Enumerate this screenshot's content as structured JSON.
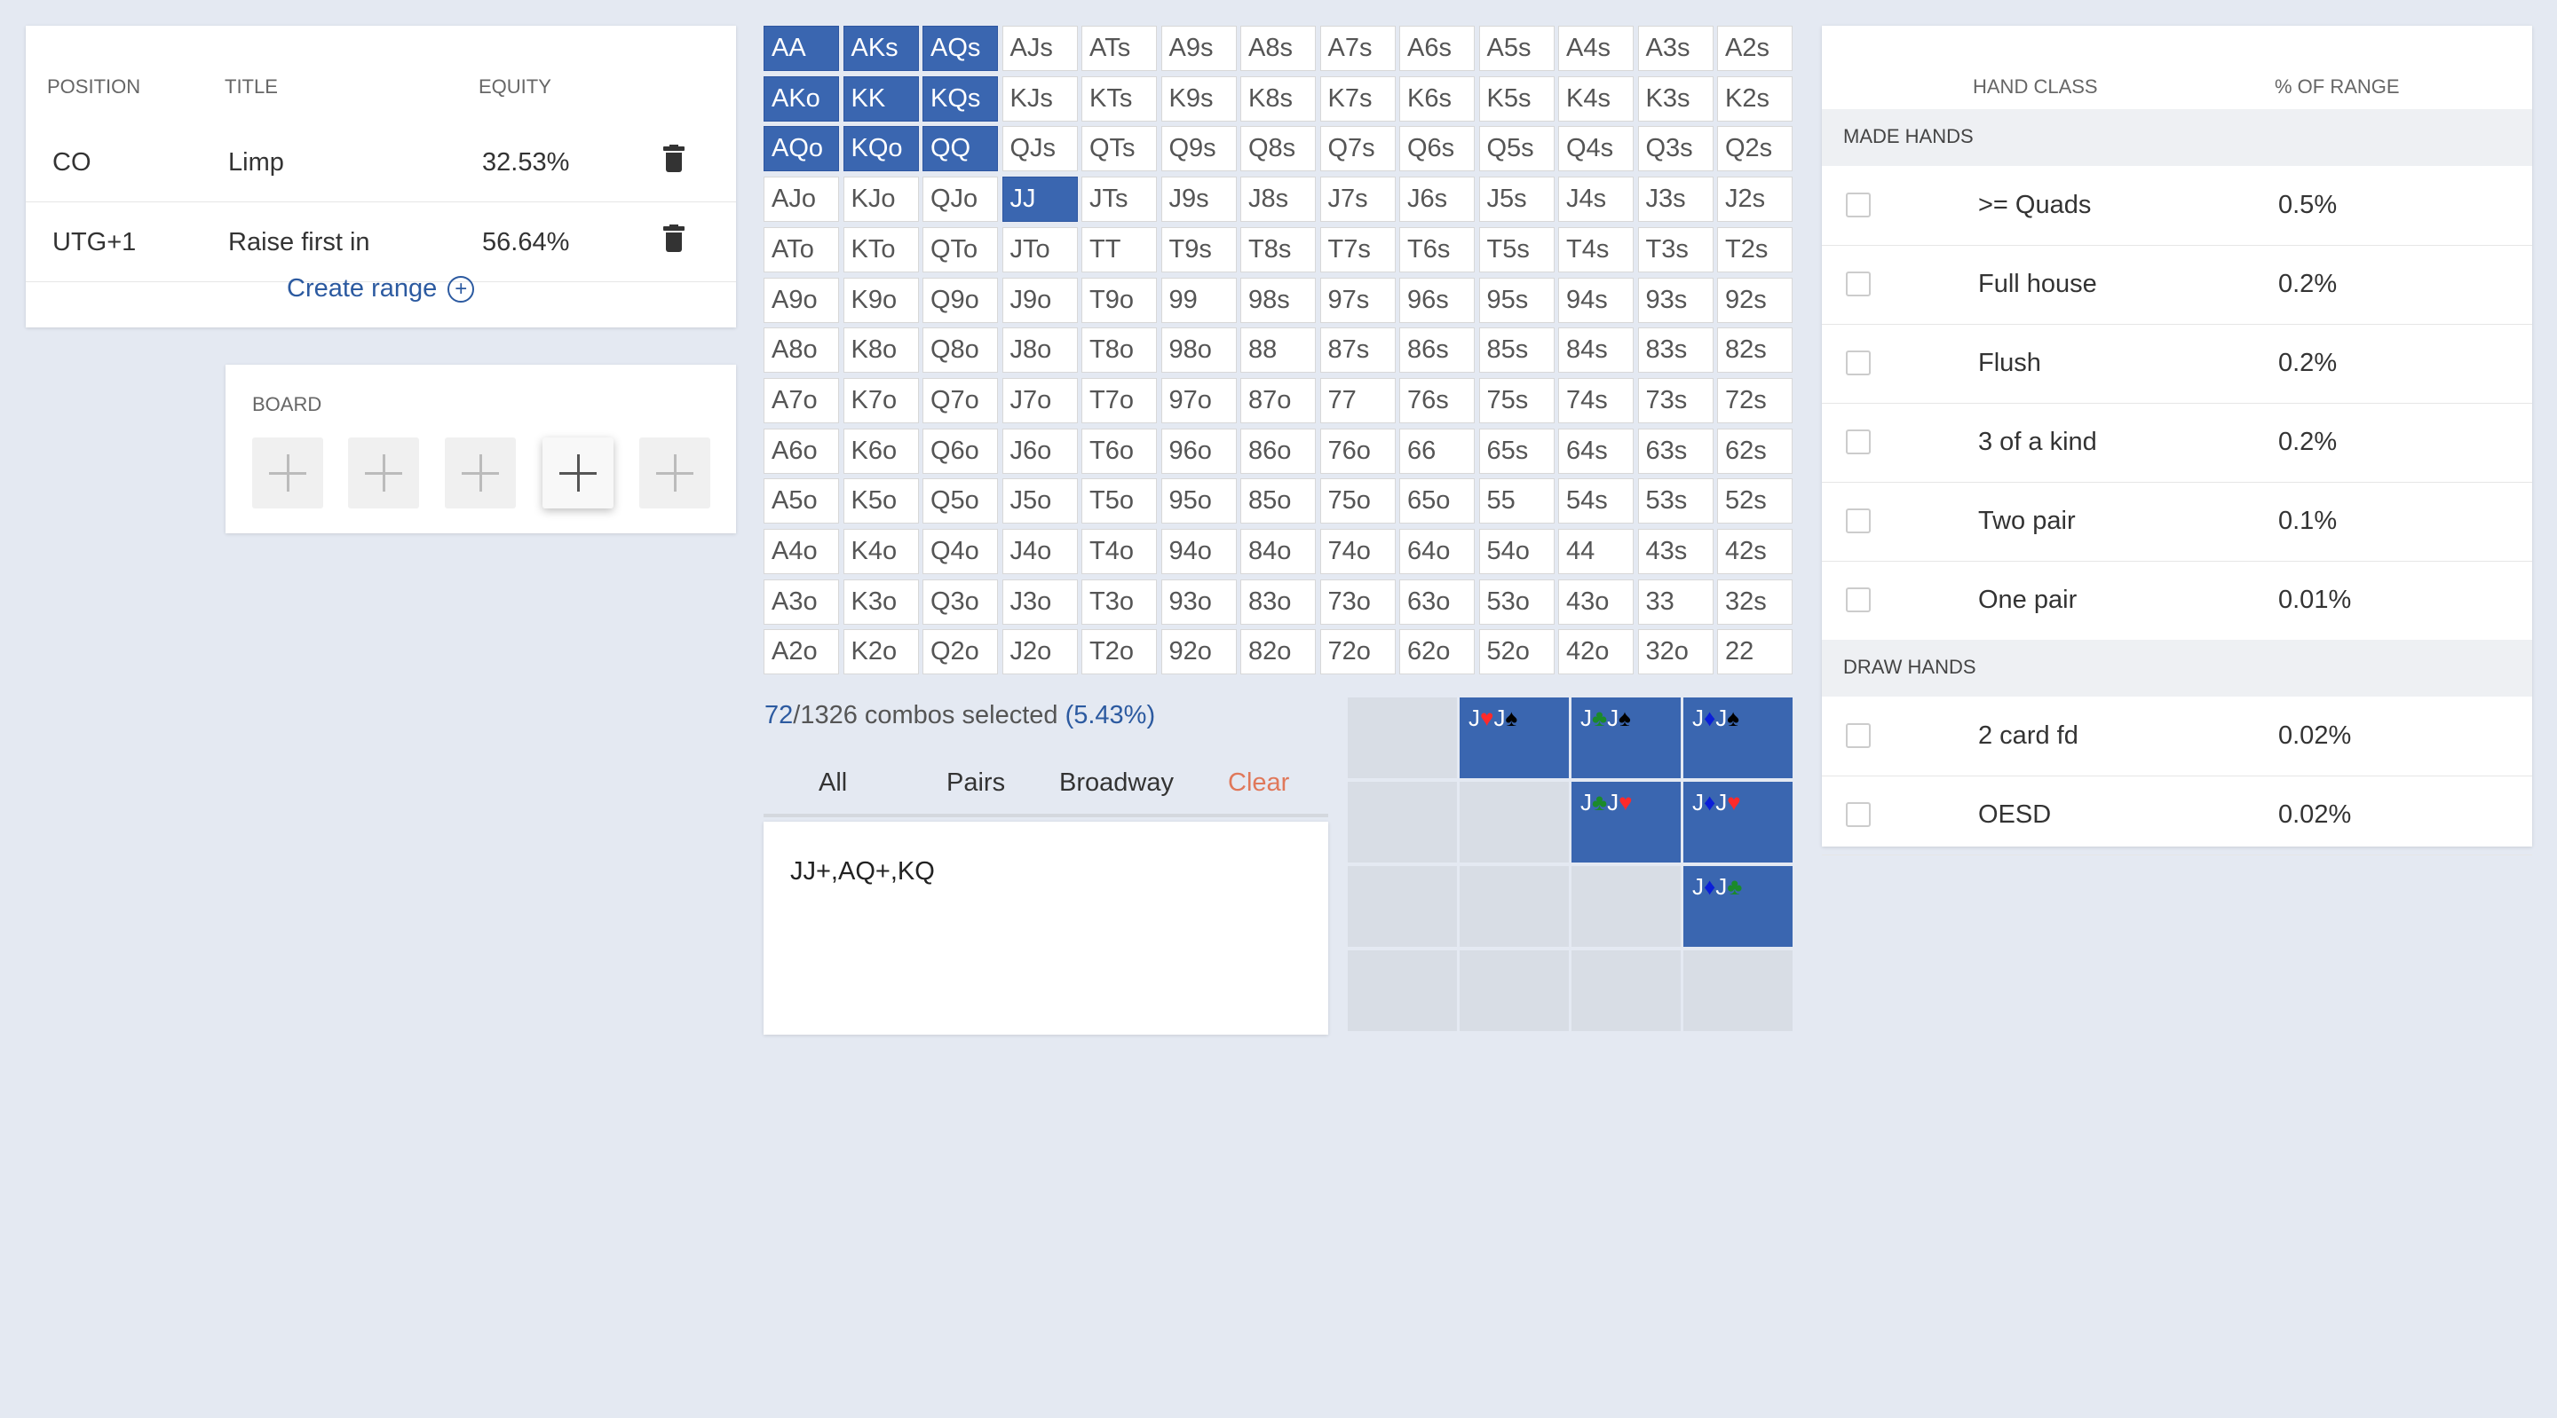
{
  "ranges": {
    "headers": {
      "position": "POSITION",
      "title": "TITLE",
      "equity": "EQUITY"
    },
    "rows": [
      {
        "position": "CO",
        "title": "Limp",
        "equity": "32.53%"
      },
      {
        "position": "UTG+1",
        "title": "Raise first in",
        "equity": "56.64%"
      }
    ],
    "create_label": "Create range",
    "create_icon": "plus-circle-icon"
  },
  "board": {
    "label": "BOARD",
    "slots": 5,
    "highlighted_slot": 4
  },
  "matrix": {
    "selected": [
      "AA",
      "AKs",
      "AQs",
      "AKo",
      "KK",
      "KQs",
      "AQo",
      "KQo",
      "QQ",
      "JJ"
    ],
    "rows": [
      [
        "AA",
        "AKs",
        "AQs",
        "AJs",
        "ATs",
        "A9s",
        "A8s",
        "A7s",
        "A6s",
        "A5s",
        "A4s",
        "A3s",
        "A2s"
      ],
      [
        "AKo",
        "KK",
        "KQs",
        "KJs",
        "KTs",
        "K9s",
        "K8s",
        "K7s",
        "K6s",
        "K5s",
        "K4s",
        "K3s",
        "K2s"
      ],
      [
        "AQo",
        "KQo",
        "QQ",
        "QJs",
        "QTs",
        "Q9s",
        "Q8s",
        "Q7s",
        "Q6s",
        "Q5s",
        "Q4s",
        "Q3s",
        "Q2s"
      ],
      [
        "AJo",
        "KJo",
        "QJo",
        "JJ",
        "JTs",
        "J9s",
        "J8s",
        "J7s",
        "J6s",
        "J5s",
        "J4s",
        "J3s",
        "J2s"
      ],
      [
        "ATo",
        "KTo",
        "QTo",
        "JTo",
        "TT",
        "T9s",
        "T8s",
        "T7s",
        "T6s",
        "T5s",
        "T4s",
        "T3s",
        "T2s"
      ],
      [
        "A9o",
        "K9o",
        "Q9o",
        "J9o",
        "T9o",
        "99",
        "98s",
        "97s",
        "96s",
        "95s",
        "94s",
        "93s",
        "92s"
      ],
      [
        "A8o",
        "K8o",
        "Q8o",
        "J8o",
        "T8o",
        "98o",
        "88",
        "87s",
        "86s",
        "85s",
        "84s",
        "83s",
        "82s"
      ],
      [
        "A7o",
        "K7o",
        "Q7o",
        "J7o",
        "T7o",
        "97o",
        "87o",
        "77",
        "76s",
        "75s",
        "74s",
        "73s",
        "72s"
      ],
      [
        "A6o",
        "K6o",
        "Q6o",
        "J6o",
        "T6o",
        "96o",
        "86o",
        "76o",
        "66",
        "65s",
        "64s",
        "63s",
        "62s"
      ],
      [
        "A5o",
        "K5o",
        "Q5o",
        "J5o",
        "T5o",
        "95o",
        "85o",
        "75o",
        "65o",
        "55",
        "54s",
        "53s",
        "52s"
      ],
      [
        "A4o",
        "K4o",
        "Q4o",
        "J4o",
        "T4o",
        "94o",
        "84o",
        "74o",
        "64o",
        "54o",
        "44",
        "43s",
        "42s"
      ],
      [
        "A3o",
        "K3o",
        "Q3o",
        "J3o",
        "T3o",
        "93o",
        "83o",
        "73o",
        "63o",
        "53o",
        "43o",
        "33",
        "32s"
      ],
      [
        "A2o",
        "K2o",
        "Q2o",
        "J2o",
        "T2o",
        "92o",
        "82o",
        "72o",
        "62o",
        "52o",
        "42o",
        "32o",
        "22"
      ]
    ]
  },
  "combos": {
    "selected": "72",
    "total": "/1326 combos selected ",
    "percent": "(5.43%)"
  },
  "filters": {
    "all": "All",
    "pairs": "Pairs",
    "broadway": "Broadway",
    "clear": "Clear"
  },
  "range_text": "JJ+,AQ+,KQ",
  "combo_grid": {
    "cells": [
      {
        "row": 0,
        "col": 1,
        "c1": "J",
        "s1": "♥",
        "k1": "red",
        "c2": "J",
        "s2": "♠",
        "k2": "blk"
      },
      {
        "row": 0,
        "col": 2,
        "c1": "J",
        "s1": "♣",
        "k1": "grn",
        "c2": "J",
        "s2": "♠",
        "k2": "blk"
      },
      {
        "row": 0,
        "col": 3,
        "c1": "J",
        "s1": "♦",
        "k1": "blu",
        "c2": "J",
        "s2": "♠",
        "k2": "blk"
      },
      {
        "row": 1,
        "col": 2,
        "c1": "J",
        "s1": "♣",
        "k1": "grn",
        "c2": "J",
        "s2": "♥",
        "k2": "red"
      },
      {
        "row": 1,
        "col": 3,
        "c1": "J",
        "s1": "♦",
        "k1": "blu",
        "c2": "J",
        "s2": "♥",
        "k2": "red"
      },
      {
        "row": 2,
        "col": 3,
        "c1": "J",
        "s1": "♦",
        "k1": "blu",
        "c2": "J",
        "s2": "♣",
        "k2": "grn"
      }
    ]
  },
  "hand_class": {
    "headers": {
      "class": "HAND CLASS",
      "percent": "% OF RANGE"
    },
    "made_label": "MADE HANDS",
    "made": [
      {
        "name": ">= Quads",
        "pct": "0.5%"
      },
      {
        "name": "Full house",
        "pct": "0.2%"
      },
      {
        "name": "Flush",
        "pct": "0.2%"
      },
      {
        "name": "3 of a kind",
        "pct": "0.2%"
      },
      {
        "name": "Two pair",
        "pct": "0.1%"
      },
      {
        "name": "One pair",
        "pct": "0.01%"
      }
    ],
    "draw_label": "DRAW HANDS",
    "draw": [
      {
        "name": "2 card fd",
        "pct": "0.02%"
      },
      {
        "name": "OESD",
        "pct": "0.02%"
      }
    ]
  },
  "colors": {
    "accent": "#3a66b0",
    "link": "#2c5aa0",
    "clear": "#e0785a",
    "background": "#e4e9f2"
  }
}
